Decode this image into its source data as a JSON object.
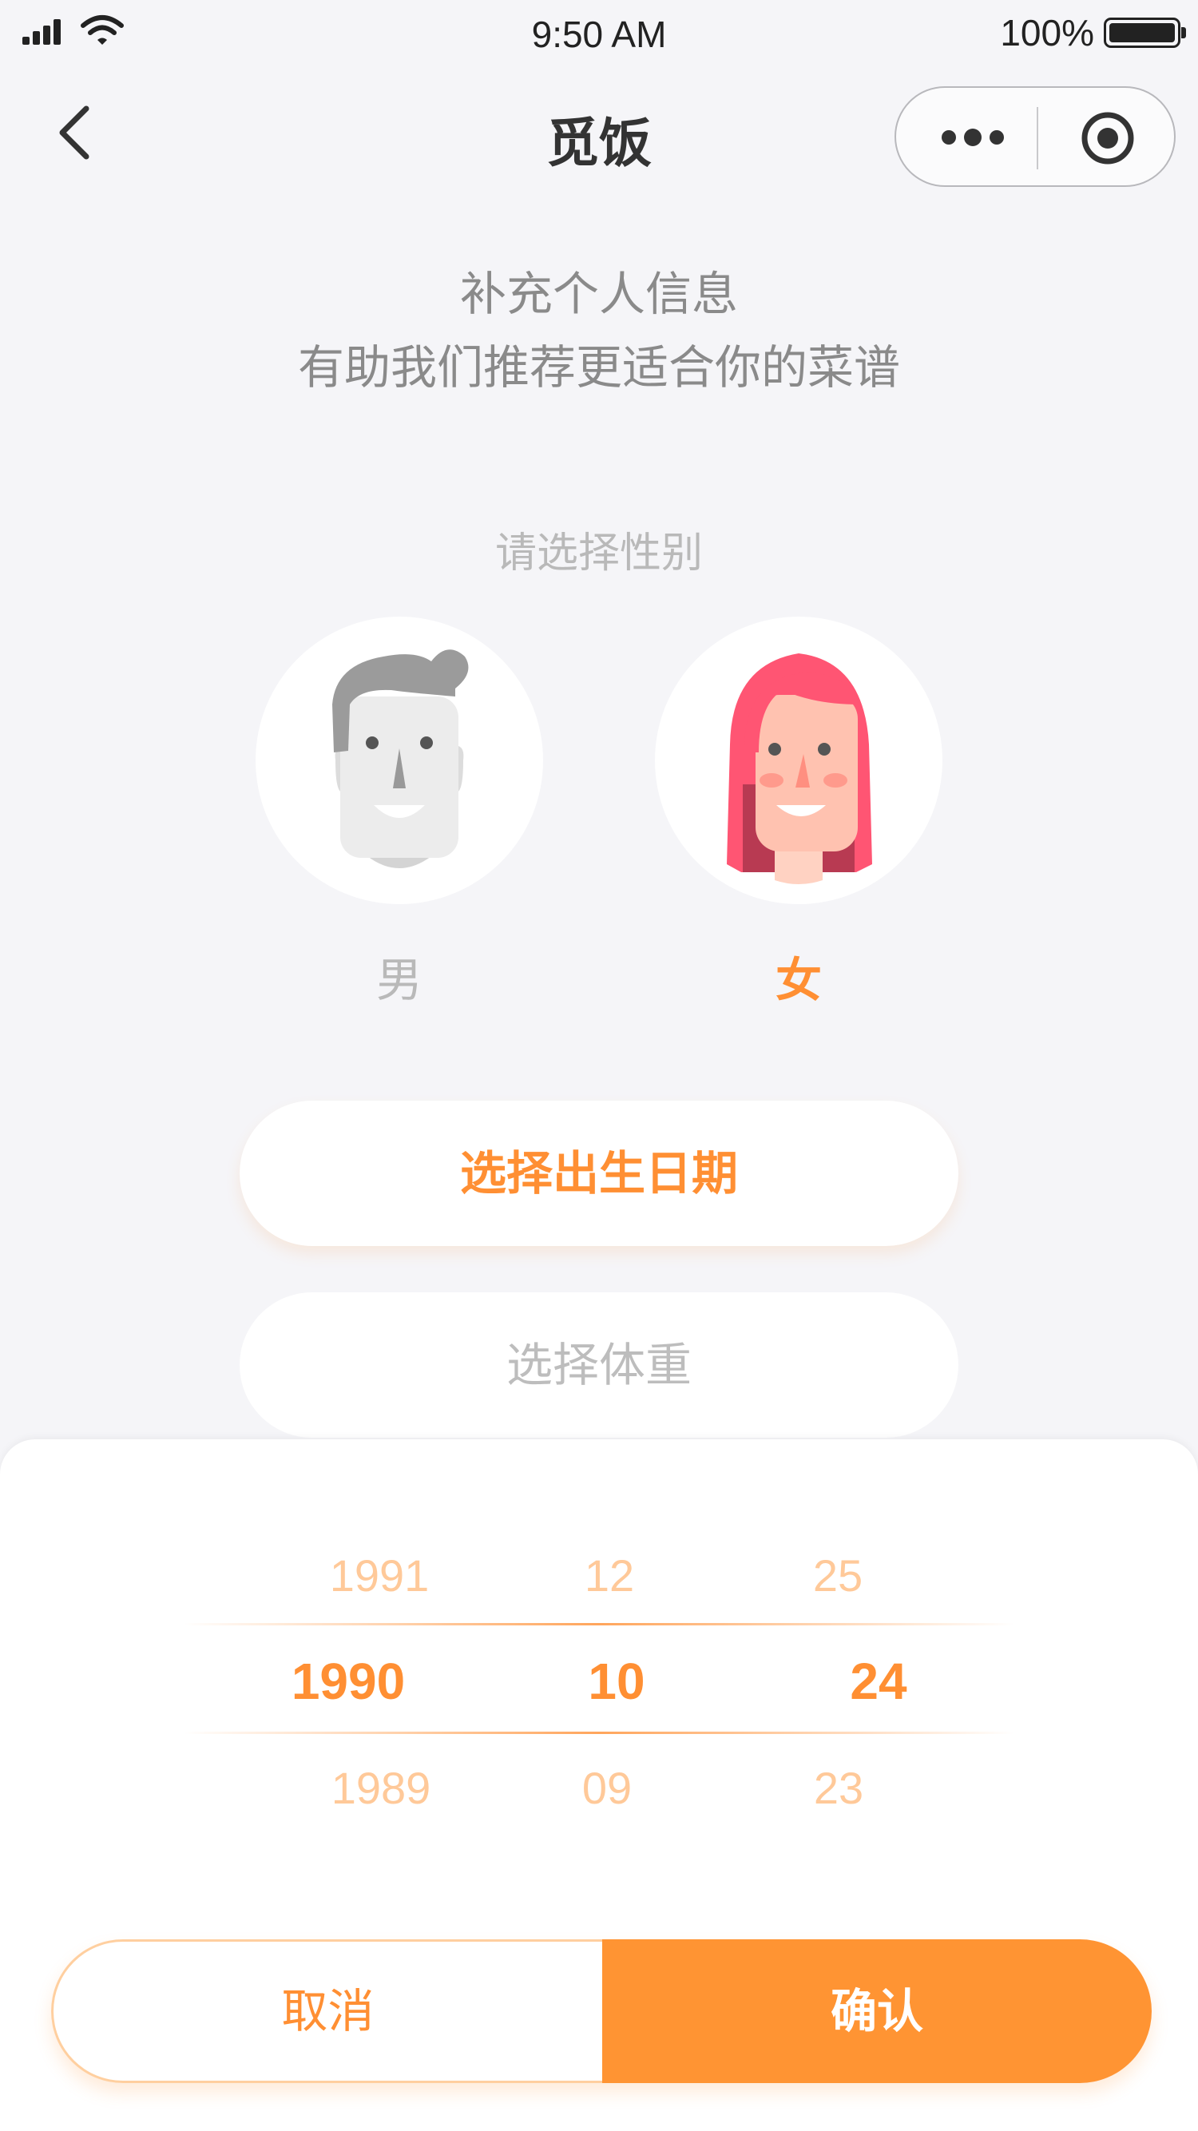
{
  "status_bar": {
    "time": "9:50 AM",
    "battery_percent": "100%",
    "battery_level": 1.0,
    "icons": [
      "signal-icon",
      "wifi-icon",
      "battery-icon"
    ]
  },
  "nav": {
    "title": "觅饭",
    "icons": [
      "back-arrow-icon",
      "more-dots-icon",
      "target-icon"
    ]
  },
  "intro": {
    "line1": "补充个人信息",
    "line2": "有助我们推荐更适合你的菜谱"
  },
  "gender": {
    "prompt": "请选择性别",
    "options": [
      {
        "label": "男",
        "selected": false,
        "icon": "male-avatar-icon"
      },
      {
        "label": "女",
        "selected": true,
        "icon": "female-avatar-icon"
      }
    ]
  },
  "buttons": {
    "birth_date": "选择出生日期",
    "weight": "选择体重"
  },
  "picker": {
    "years": [
      "1991",
      "1990",
      "1989"
    ],
    "months": [
      "12",
      "10",
      "09"
    ],
    "days": [
      "25",
      "24",
      "23"
    ],
    "selected": {
      "year": "1990",
      "month": "10",
      "day": "24"
    },
    "cancel_label": "取消",
    "confirm_label": "确认"
  },
  "colors": {
    "accent": "#ff8f33",
    "accent_faded": "#ffc999",
    "background": "#f5f5f8",
    "female_hair": "#ff5573"
  }
}
